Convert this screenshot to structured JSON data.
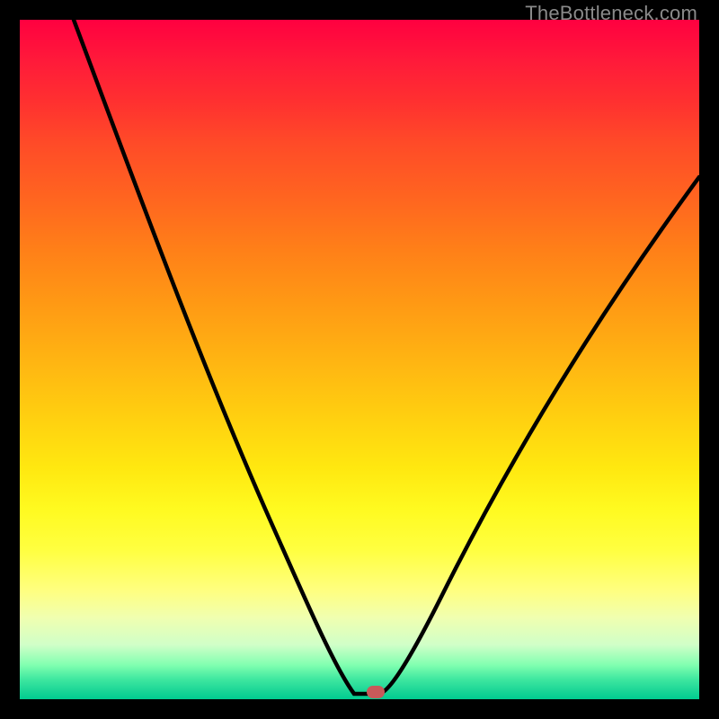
{
  "watermark": "TheBottleneck.com",
  "chart_data": {
    "type": "line",
    "title": "",
    "xlabel": "",
    "ylabel": "",
    "xlim": [
      0,
      100
    ],
    "ylim": [
      0,
      100
    ],
    "x": [
      0,
      5,
      10,
      15,
      20,
      25,
      30,
      35,
      40,
      45,
      48,
      50,
      52,
      53,
      55,
      60,
      65,
      70,
      75,
      80,
      85,
      90,
      95,
      100
    ],
    "values": [
      100,
      92,
      83,
      74,
      65,
      56,
      47,
      38,
      28,
      16,
      6,
      0,
      0,
      0,
      4,
      12,
      20,
      28,
      35,
      42,
      49,
      55,
      61,
      67
    ],
    "minimum_x": 52,
    "minimum_y": 0,
    "marker": {
      "x": 52,
      "y": 0
    },
    "gradient_stops": [
      {
        "pos": 0,
        "color": "#ff0040"
      },
      {
        "pos": 50,
        "color": "#ffce10"
      },
      {
        "pos": 80,
        "color": "#ffff60"
      },
      {
        "pos": 100,
        "color": "#00cc90"
      }
    ]
  }
}
